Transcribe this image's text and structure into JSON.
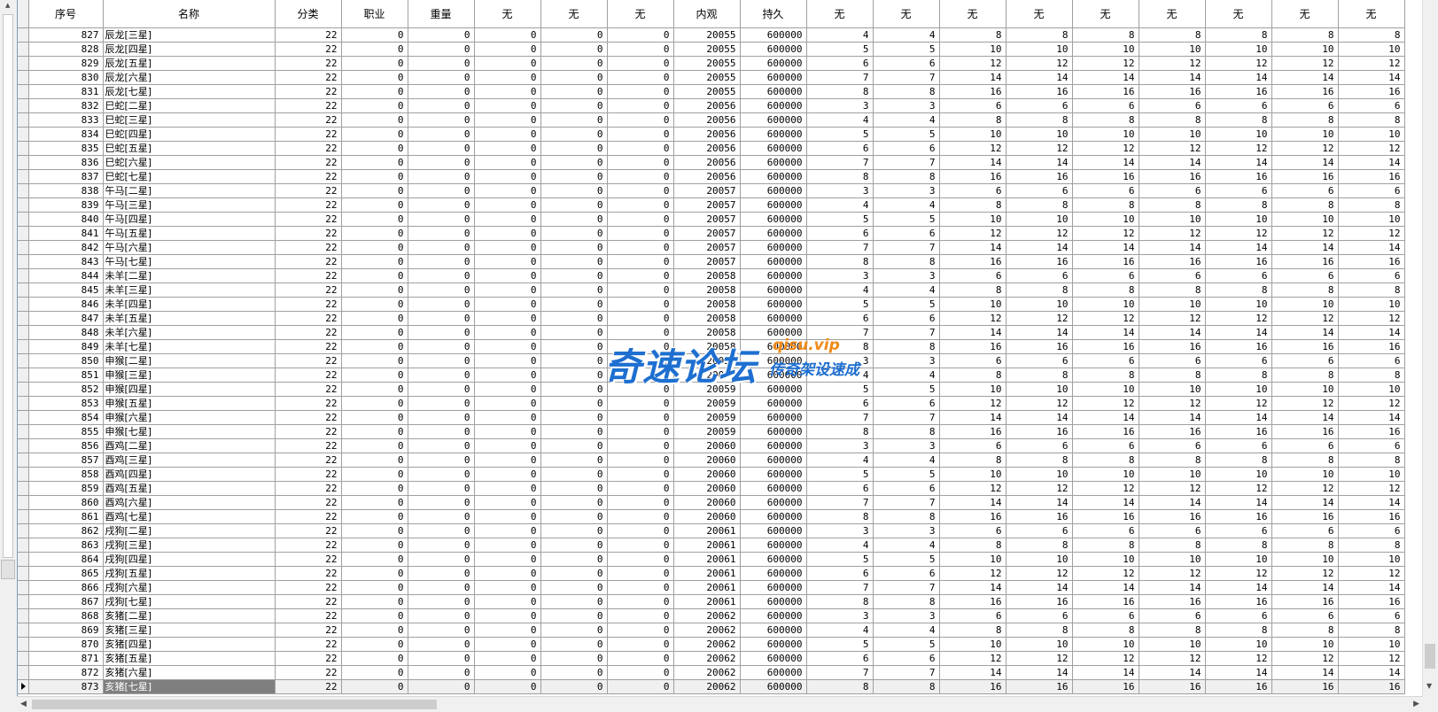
{
  "columns": [
    "序号",
    "名称",
    "分类",
    "职业",
    "重量",
    "无",
    "无",
    "无",
    "内观",
    "持久",
    "无",
    "无",
    "无",
    "无",
    "无",
    "无",
    "无",
    "无",
    "无"
  ],
  "current_row_index": 46,
  "rows": [
    [
      "827",
      "辰龙[三星]",
      "22",
      "0",
      "0",
      "0",
      "0",
      "0",
      "20055",
      "600000",
      "4",
      "4",
      "8",
      "8",
      "8",
      "8",
      "8",
      "8",
      "8"
    ],
    [
      "828",
      "辰龙[四星]",
      "22",
      "0",
      "0",
      "0",
      "0",
      "0",
      "20055",
      "600000",
      "5",
      "5",
      "10",
      "10",
      "10",
      "10",
      "10",
      "10",
      "10"
    ],
    [
      "829",
      "辰龙[五星]",
      "22",
      "0",
      "0",
      "0",
      "0",
      "0",
      "20055",
      "600000",
      "6",
      "6",
      "12",
      "12",
      "12",
      "12",
      "12",
      "12",
      "12"
    ],
    [
      "830",
      "辰龙[六星]",
      "22",
      "0",
      "0",
      "0",
      "0",
      "0",
      "20055",
      "600000",
      "7",
      "7",
      "14",
      "14",
      "14",
      "14",
      "14",
      "14",
      "14"
    ],
    [
      "831",
      "辰龙[七星]",
      "22",
      "0",
      "0",
      "0",
      "0",
      "0",
      "20055",
      "600000",
      "8",
      "8",
      "16",
      "16",
      "16",
      "16",
      "16",
      "16",
      "16"
    ],
    [
      "832",
      "巳蛇[二星]",
      "22",
      "0",
      "0",
      "0",
      "0",
      "0",
      "20056",
      "600000",
      "3",
      "3",
      "6",
      "6",
      "6",
      "6",
      "6",
      "6",
      "6"
    ],
    [
      "833",
      "巳蛇[三星]",
      "22",
      "0",
      "0",
      "0",
      "0",
      "0",
      "20056",
      "600000",
      "4",
      "4",
      "8",
      "8",
      "8",
      "8",
      "8",
      "8",
      "8"
    ],
    [
      "834",
      "巳蛇[四星]",
      "22",
      "0",
      "0",
      "0",
      "0",
      "0",
      "20056",
      "600000",
      "5",
      "5",
      "10",
      "10",
      "10",
      "10",
      "10",
      "10",
      "10"
    ],
    [
      "835",
      "巳蛇[五星]",
      "22",
      "0",
      "0",
      "0",
      "0",
      "0",
      "20056",
      "600000",
      "6",
      "6",
      "12",
      "12",
      "12",
      "12",
      "12",
      "12",
      "12"
    ],
    [
      "836",
      "巳蛇[六星]",
      "22",
      "0",
      "0",
      "0",
      "0",
      "0",
      "20056",
      "600000",
      "7",
      "7",
      "14",
      "14",
      "14",
      "14",
      "14",
      "14",
      "14"
    ],
    [
      "837",
      "巳蛇[七星]",
      "22",
      "0",
      "0",
      "0",
      "0",
      "0",
      "20056",
      "600000",
      "8",
      "8",
      "16",
      "16",
      "16",
      "16",
      "16",
      "16",
      "16"
    ],
    [
      "838",
      "午马[二星]",
      "22",
      "0",
      "0",
      "0",
      "0",
      "0",
      "20057",
      "600000",
      "3",
      "3",
      "6",
      "6",
      "6",
      "6",
      "6",
      "6",
      "6"
    ],
    [
      "839",
      "午马[三星]",
      "22",
      "0",
      "0",
      "0",
      "0",
      "0",
      "20057",
      "600000",
      "4",
      "4",
      "8",
      "8",
      "8",
      "8",
      "8",
      "8",
      "8"
    ],
    [
      "840",
      "午马[四星]",
      "22",
      "0",
      "0",
      "0",
      "0",
      "0",
      "20057",
      "600000",
      "5",
      "5",
      "10",
      "10",
      "10",
      "10",
      "10",
      "10",
      "10"
    ],
    [
      "841",
      "午马[五星]",
      "22",
      "0",
      "0",
      "0",
      "0",
      "0",
      "20057",
      "600000",
      "6",
      "6",
      "12",
      "12",
      "12",
      "12",
      "12",
      "12",
      "12"
    ],
    [
      "842",
      "午马[六星]",
      "22",
      "0",
      "0",
      "0",
      "0",
      "0",
      "20057",
      "600000",
      "7",
      "7",
      "14",
      "14",
      "14",
      "14",
      "14",
      "14",
      "14"
    ],
    [
      "843",
      "午马[七星]",
      "22",
      "0",
      "0",
      "0",
      "0",
      "0",
      "20057",
      "600000",
      "8",
      "8",
      "16",
      "16",
      "16",
      "16",
      "16",
      "16",
      "16"
    ],
    [
      "844",
      "未羊[二星]",
      "22",
      "0",
      "0",
      "0",
      "0",
      "0",
      "20058",
      "600000",
      "3",
      "3",
      "6",
      "6",
      "6",
      "6",
      "6",
      "6",
      "6"
    ],
    [
      "845",
      "未羊[三星]",
      "22",
      "0",
      "0",
      "0",
      "0",
      "0",
      "20058",
      "600000",
      "4",
      "4",
      "8",
      "8",
      "8",
      "8",
      "8",
      "8",
      "8"
    ],
    [
      "846",
      "未羊[四星]",
      "22",
      "0",
      "0",
      "0",
      "0",
      "0",
      "20058",
      "600000",
      "5",
      "5",
      "10",
      "10",
      "10",
      "10",
      "10",
      "10",
      "10"
    ],
    [
      "847",
      "未羊[五星]",
      "22",
      "0",
      "0",
      "0",
      "0",
      "0",
      "20058",
      "600000",
      "6",
      "6",
      "12",
      "12",
      "12",
      "12",
      "12",
      "12",
      "12"
    ],
    [
      "848",
      "未羊[六星]",
      "22",
      "0",
      "0",
      "0",
      "0",
      "0",
      "20058",
      "600000",
      "7",
      "7",
      "14",
      "14",
      "14",
      "14",
      "14",
      "14",
      "14"
    ],
    [
      "849",
      "未羊[七星]",
      "22",
      "0",
      "0",
      "0",
      "0",
      "0",
      "20058",
      "600000",
      "8",
      "8",
      "16",
      "16",
      "16",
      "16",
      "16",
      "16",
      "16"
    ],
    [
      "850",
      "申猴[二星]",
      "22",
      "0",
      "0",
      "0",
      "0",
      "0",
      "20059",
      "600000",
      "3",
      "3",
      "6",
      "6",
      "6",
      "6",
      "6",
      "6",
      "6"
    ],
    [
      "851",
      "申猴[三星]",
      "22",
      "0",
      "0",
      "0",
      "0",
      "0",
      "20059",
      "600000",
      "4",
      "4",
      "8",
      "8",
      "8",
      "8",
      "8",
      "8",
      "8"
    ],
    [
      "852",
      "申猴[四星]",
      "22",
      "0",
      "0",
      "0",
      "0",
      "0",
      "20059",
      "600000",
      "5",
      "5",
      "10",
      "10",
      "10",
      "10",
      "10",
      "10",
      "10"
    ],
    [
      "853",
      "申猴[五星]",
      "22",
      "0",
      "0",
      "0",
      "0",
      "0",
      "20059",
      "600000",
      "6",
      "6",
      "12",
      "12",
      "12",
      "12",
      "12",
      "12",
      "12"
    ],
    [
      "854",
      "申猴[六星]",
      "22",
      "0",
      "0",
      "0",
      "0",
      "0",
      "20059",
      "600000",
      "7",
      "7",
      "14",
      "14",
      "14",
      "14",
      "14",
      "14",
      "14"
    ],
    [
      "855",
      "申猴[七星]",
      "22",
      "0",
      "0",
      "0",
      "0",
      "0",
      "20059",
      "600000",
      "8",
      "8",
      "16",
      "16",
      "16",
      "16",
      "16",
      "16",
      "16"
    ],
    [
      "856",
      "酉鸡[二星]",
      "22",
      "0",
      "0",
      "0",
      "0",
      "0",
      "20060",
      "600000",
      "3",
      "3",
      "6",
      "6",
      "6",
      "6",
      "6",
      "6",
      "6"
    ],
    [
      "857",
      "酉鸡[三星]",
      "22",
      "0",
      "0",
      "0",
      "0",
      "0",
      "20060",
      "600000",
      "4",
      "4",
      "8",
      "8",
      "8",
      "8",
      "8",
      "8",
      "8"
    ],
    [
      "858",
      "酉鸡[四星]",
      "22",
      "0",
      "0",
      "0",
      "0",
      "0",
      "20060",
      "600000",
      "5",
      "5",
      "10",
      "10",
      "10",
      "10",
      "10",
      "10",
      "10"
    ],
    [
      "859",
      "酉鸡[五星]",
      "22",
      "0",
      "0",
      "0",
      "0",
      "0",
      "20060",
      "600000",
      "6",
      "6",
      "12",
      "12",
      "12",
      "12",
      "12",
      "12",
      "12"
    ],
    [
      "860",
      "酉鸡[六星]",
      "22",
      "0",
      "0",
      "0",
      "0",
      "0",
      "20060",
      "600000",
      "7",
      "7",
      "14",
      "14",
      "14",
      "14",
      "14",
      "14",
      "14"
    ],
    [
      "861",
      "酉鸡[七星]",
      "22",
      "0",
      "0",
      "0",
      "0",
      "0",
      "20060",
      "600000",
      "8",
      "8",
      "16",
      "16",
      "16",
      "16",
      "16",
      "16",
      "16"
    ],
    [
      "862",
      "戌狗[二星]",
      "22",
      "0",
      "0",
      "0",
      "0",
      "0",
      "20061",
      "600000",
      "3",
      "3",
      "6",
      "6",
      "6",
      "6",
      "6",
      "6",
      "6"
    ],
    [
      "863",
      "戌狗[三星]",
      "22",
      "0",
      "0",
      "0",
      "0",
      "0",
      "20061",
      "600000",
      "4",
      "4",
      "8",
      "8",
      "8",
      "8",
      "8",
      "8",
      "8"
    ],
    [
      "864",
      "戌狗[四星]",
      "22",
      "0",
      "0",
      "0",
      "0",
      "0",
      "20061",
      "600000",
      "5",
      "5",
      "10",
      "10",
      "10",
      "10",
      "10",
      "10",
      "10"
    ],
    [
      "865",
      "戌狗[五星]",
      "22",
      "0",
      "0",
      "0",
      "0",
      "0",
      "20061",
      "600000",
      "6",
      "6",
      "12",
      "12",
      "12",
      "12",
      "12",
      "12",
      "12"
    ],
    [
      "866",
      "戌狗[六星]",
      "22",
      "0",
      "0",
      "0",
      "0",
      "0",
      "20061",
      "600000",
      "7",
      "7",
      "14",
      "14",
      "14",
      "14",
      "14",
      "14",
      "14"
    ],
    [
      "867",
      "戌狗[七星]",
      "22",
      "0",
      "0",
      "0",
      "0",
      "0",
      "20061",
      "600000",
      "8",
      "8",
      "16",
      "16",
      "16",
      "16",
      "16",
      "16",
      "16"
    ],
    [
      "868",
      "亥猪[二星]",
      "22",
      "0",
      "0",
      "0",
      "0",
      "0",
      "20062",
      "600000",
      "3",
      "3",
      "6",
      "6",
      "6",
      "6",
      "6",
      "6",
      "6"
    ],
    [
      "869",
      "亥猪[三星]",
      "22",
      "0",
      "0",
      "0",
      "0",
      "0",
      "20062",
      "600000",
      "4",
      "4",
      "8",
      "8",
      "8",
      "8",
      "8",
      "8",
      "8"
    ],
    [
      "870",
      "亥猪[四星]",
      "22",
      "0",
      "0",
      "0",
      "0",
      "0",
      "20062",
      "600000",
      "5",
      "5",
      "10",
      "10",
      "10",
      "10",
      "10",
      "10",
      "10"
    ],
    [
      "871",
      "亥猪[五星]",
      "22",
      "0",
      "0",
      "0",
      "0",
      "0",
      "20062",
      "600000",
      "6",
      "6",
      "12",
      "12",
      "12",
      "12",
      "12",
      "12",
      "12"
    ],
    [
      "872",
      "亥猪[六星]",
      "22",
      "0",
      "0",
      "0",
      "0",
      "0",
      "20062",
      "600000",
      "7",
      "7",
      "14",
      "14",
      "14",
      "14",
      "14",
      "14",
      "14"
    ],
    [
      "873",
      "亥猪[七星]",
      "22",
      "0",
      "0",
      "0",
      "0",
      "0",
      "20062",
      "600000",
      "8",
      "8",
      "16",
      "16",
      "16",
      "16",
      "16",
      "16",
      "16"
    ]
  ],
  "icons": {
    "row_pointer": "triangle-right-icon",
    "scroll_up": "arrow-up-icon",
    "scroll_down": "arrow-down-icon",
    "scroll_left": "arrow-left-icon",
    "scroll_right": "arrow-right-icon"
  },
  "watermark": {
    "main": "奇速论坛",
    "url": "qisu.vip",
    "sub": "传奇架设速成"
  },
  "colors": {
    "grid_line": "#a0a0a0",
    "selected_cell": "#7f7f7f",
    "watermark_blue": "#1e6fd0",
    "watermark_orange": "#f08a17"
  }
}
